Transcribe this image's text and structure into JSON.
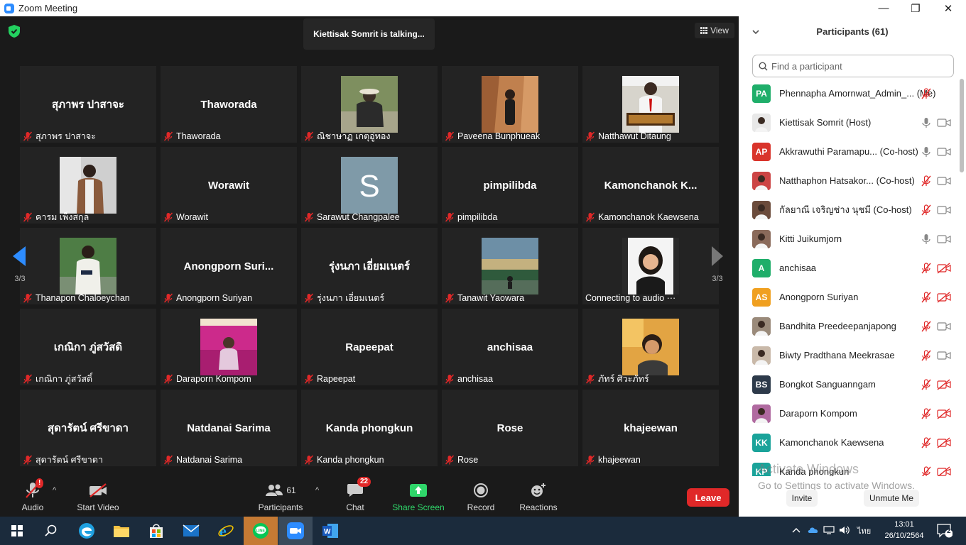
{
  "window": {
    "title": "Zoom Meeting",
    "minimize": "—",
    "maximize": "❐",
    "close": "✕"
  },
  "meeting": {
    "talking_banner": "Kiettisak Somrit is talking...",
    "view_label": "View",
    "page_indicator": "3/3",
    "tiles": [
      {
        "big": "สุภาพร ปาสาจะ",
        "name": "สุภาพร ปาสาจะ",
        "photo": ""
      },
      {
        "big": "Thaworada",
        "name": "Thaworada",
        "photo": ""
      },
      {
        "big": "",
        "name": "ณิชาษาฏ เกตุอู่ทอง",
        "photo": "forest"
      },
      {
        "big": "",
        "name": "Paveena Bunphueak",
        "photo": "rock"
      },
      {
        "big": "",
        "name": "Natthawut Ditaung",
        "photo": "sign"
      },
      {
        "big": "",
        "name": "คารม เพ็งสกุล",
        "photo": "man"
      },
      {
        "big": "Worawit",
        "name": "Worawit",
        "photo": ""
      },
      {
        "big": "",
        "name": "Sarawut Changpalee",
        "photo": "s"
      },
      {
        "big": "pimpilibda",
        "name": "pimpilibda",
        "photo": ""
      },
      {
        "big": "Kamonchanok  K...",
        "name": "Kamonchanok Kaewsena",
        "photo": ""
      },
      {
        "big": "",
        "name": "Thanapon Chaloeychan",
        "photo": "phone"
      },
      {
        "big": "Anongporn  Suri...",
        "name": "Anongporn Suriyan",
        "photo": ""
      },
      {
        "big": "รุ่งนภา เอี่ยมเนตร์",
        "name": "รุ่งนภา เอี่ยมเนตร์",
        "photo": ""
      },
      {
        "big": "",
        "name": "Tanawit Yaowara",
        "photo": "sky"
      },
      {
        "big": "",
        "name": "Connecting to audio ···",
        "photo": "girl"
      },
      {
        "big": "เกณิกา ภู่สวัสดิ",
        "name": "เกณิกา ภู่สวัสดิ์",
        "photo": ""
      },
      {
        "big": "",
        "name": "Daraporn Kompom",
        "photo": "pink"
      },
      {
        "big": "Rapeepat",
        "name": "Rapeepat",
        "photo": ""
      },
      {
        "big": "anchisaa",
        "name": "anchisaa",
        "photo": ""
      },
      {
        "big": "",
        "name": "ภัทร์ ศิวะภัทร์",
        "photo": "boy"
      },
      {
        "big": "สุดารัตน์ ศรีขาดา",
        "name": "สุดารัตน์ ศรีขาดา",
        "photo": ""
      },
      {
        "big": "Natdanai Sarima",
        "name": "Natdanai Sarima",
        "photo": ""
      },
      {
        "big": "Kanda phongkun",
        "name": "Kanda phongkun",
        "photo": ""
      },
      {
        "big": "Rose",
        "name": "Rose",
        "photo": ""
      },
      {
        "big": "khajeewan",
        "name": "khajeewan",
        "photo": ""
      }
    ]
  },
  "toolbar": {
    "audio": "Audio",
    "start_video": "Start Video",
    "participants": "Participants",
    "participants_count": "61",
    "chat": "Chat",
    "chat_badge": "22",
    "share_screen": "Share Screen",
    "record": "Record",
    "reactions": "Reactions",
    "leave": "Leave",
    "audio_alert": "!"
  },
  "panel": {
    "title": "Participants (61)",
    "search_placeholder": "Find a participant",
    "participants": [
      {
        "initials": "PA",
        "color": "#1fae6a",
        "name": "Phennapha Amornwat_Admin_...",
        "role": "(Me)",
        "mic": "muted",
        "cam": "none"
      },
      {
        "initials": "",
        "color": "#e8e8e8",
        "name": "Kiettisak Somrit (Host)",
        "role": "",
        "mic": "on",
        "cam": "on"
      },
      {
        "initials": "AP",
        "color": "#d9342b",
        "name": "Akkrawuthi Paramapu...",
        "role": "(Co-host)",
        "mic": "on",
        "cam": "on"
      },
      {
        "initials": "",
        "color": "#c44",
        "name": "Natthaphon Hatsakor...",
        "role": "(Co-host)",
        "mic": "muted",
        "cam": "on"
      },
      {
        "initials": "",
        "color": "#6b4b3b",
        "name": "กัลยาณี เจริญช่าง นุชมี (Co-host)",
        "role": "",
        "mic": "muted",
        "cam": "on"
      },
      {
        "initials": "",
        "color": "#8a6a5a",
        "name": "Kitti Juikumjorn",
        "role": "",
        "mic": "on",
        "cam": "on"
      },
      {
        "initials": "A",
        "color": "#1fae6a",
        "name": "anchisaa",
        "role": "",
        "mic": "muted",
        "cam": "off"
      },
      {
        "initials": "AS",
        "color": "#f0a020",
        "name": "Anongporn Suriyan",
        "role": "",
        "mic": "muted",
        "cam": "off"
      },
      {
        "initials": "",
        "color": "#9a8a7a",
        "name": "Bandhita Preedeepanjapong",
        "role": "",
        "mic": "muted",
        "cam": "on"
      },
      {
        "initials": "",
        "color": "#c9b9a9",
        "name": "Biwty Pradthana Meekrasae",
        "role": "",
        "mic": "muted",
        "cam": "on"
      },
      {
        "initials": "BS",
        "color": "#2d3a4a",
        "name": "Bongkot Sanguanngam",
        "role": "",
        "mic": "muted",
        "cam": "off"
      },
      {
        "initials": "",
        "color": "#b06aa0",
        "name": "Daraporn Kompom",
        "role": "",
        "mic": "muted",
        "cam": "off"
      },
      {
        "initials": "KK",
        "color": "#1aa39a",
        "name": "Kamonchanok Kaewsena",
        "role": "",
        "mic": "muted",
        "cam": "off"
      },
      {
        "initials": "KP",
        "color": "#1aa39a",
        "name": "Kanda phongkun",
        "role": "",
        "mic": "muted",
        "cam": "off"
      }
    ],
    "activate_title": "Activate Windows",
    "activate_sub": "Go to Settings to activate Windows.",
    "invite": "Invite",
    "unmute_me": "Unmute Me"
  },
  "taskbar": {
    "lang": "ไทย",
    "time": "13:01",
    "date": "26/10/2564",
    "notifications": "2"
  }
}
